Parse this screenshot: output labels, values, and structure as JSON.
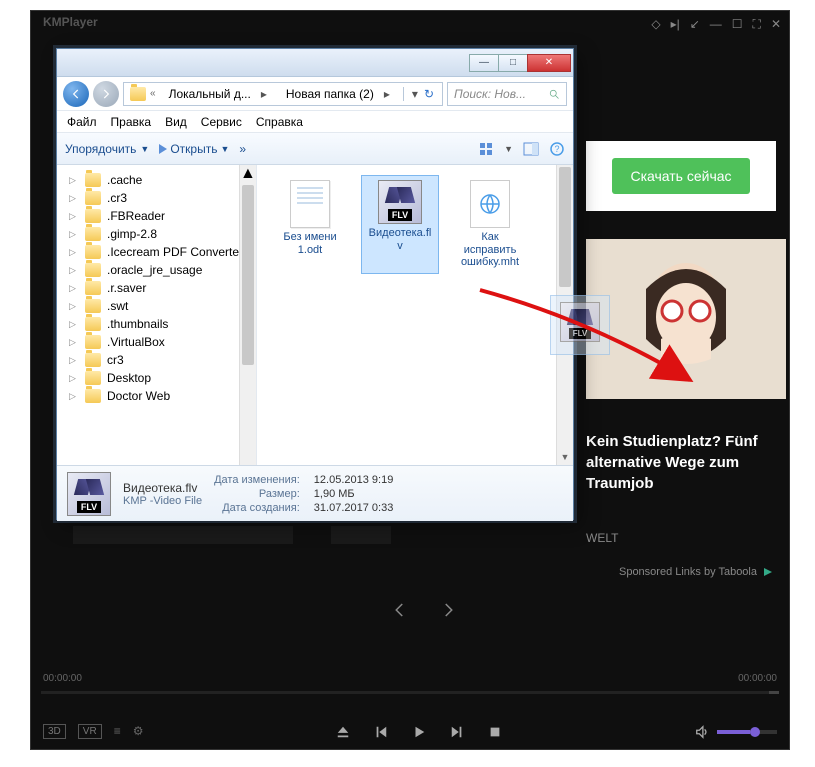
{
  "kmp": {
    "title": "KMPlayer",
    "time_left": "00:00:00",
    "time_right": "00:00:00",
    "badges": [
      "3D",
      "VR"
    ]
  },
  "ads": {
    "download_btn": "Скачать сейчас",
    "headline": "Kein Studienplatz? Fünf alternative Wege zum Traumjob",
    "source": "WELT",
    "sponsored": "Sponsored Links by Taboola"
  },
  "explorer": {
    "breadcrumb": {
      "seg1": "Локальный д...",
      "seg2": "Новая папка (2)"
    },
    "search_placeholder": "Поиск: Нов...",
    "menu": {
      "file": "Файл",
      "edit": "Правка",
      "view": "Вид",
      "tools": "Сервис",
      "help": "Справка"
    },
    "toolbar": {
      "organize": "Упорядочить",
      "open": "Открыть"
    },
    "tree": [
      ".cache",
      ".cr3",
      ".FBReader",
      ".gimp-2.8",
      ".Icecream PDF Converter",
      ".oracle_jre_usage",
      ".r.saver",
      ".swt",
      ".thumbnails",
      ".VirtualBox",
      "cr3",
      "Desktop",
      "Doctor Web"
    ],
    "files": {
      "odt": "Без имени 1.odt",
      "flv": "Видеотека.flv",
      "mht": "Как исправить ошибку.mht"
    },
    "details": {
      "name": "Видеотека.flv",
      "type": "KMP -Video File",
      "lbl_modified": "Дата изменения:",
      "val_modified": "12.05.2013 9:19",
      "lbl_size": "Размер:",
      "val_size": "1,90 МБ",
      "lbl_created": "Дата создания:",
      "val_created": "31.07.2017 0:33"
    }
  }
}
